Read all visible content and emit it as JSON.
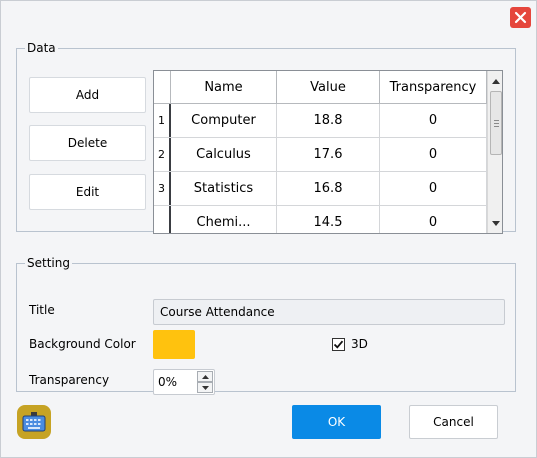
{
  "dialog": {
    "close_icon": "close-icon",
    "accent_close": "#e5463c"
  },
  "data_group": {
    "legend": "Data",
    "buttons": {
      "add": "Add",
      "delete": "Delete",
      "edit": "Edit"
    },
    "table": {
      "columns": [
        "Name",
        "Value",
        "Transparency"
      ],
      "rows": [
        {
          "num": "1",
          "name": "Computer",
          "value": "18.8",
          "transparency": "0"
        },
        {
          "num": "2",
          "name": "Calculus",
          "value": "17.6",
          "transparency": "0"
        },
        {
          "num": "3",
          "name": "Statistics",
          "value": "16.8",
          "transparency": "0"
        },
        {
          "num": "",
          "name": "Chemi...",
          "value": "14.5",
          "transparency": "0"
        }
      ]
    }
  },
  "setting_group": {
    "legend": "Setting",
    "title_label": "Title",
    "title_value": "Course Attendance",
    "bg_color_label": "Background Color",
    "bg_color": "#ffc20e",
    "threed_label": "3D",
    "threed_checked": true,
    "transparency_label": "Transparency",
    "transparency_value": "0%"
  },
  "footer": {
    "keyboard_icon": "keyboard-icon",
    "ok": "OK",
    "cancel": "Cancel",
    "ok_color": "#0a8ae6"
  }
}
